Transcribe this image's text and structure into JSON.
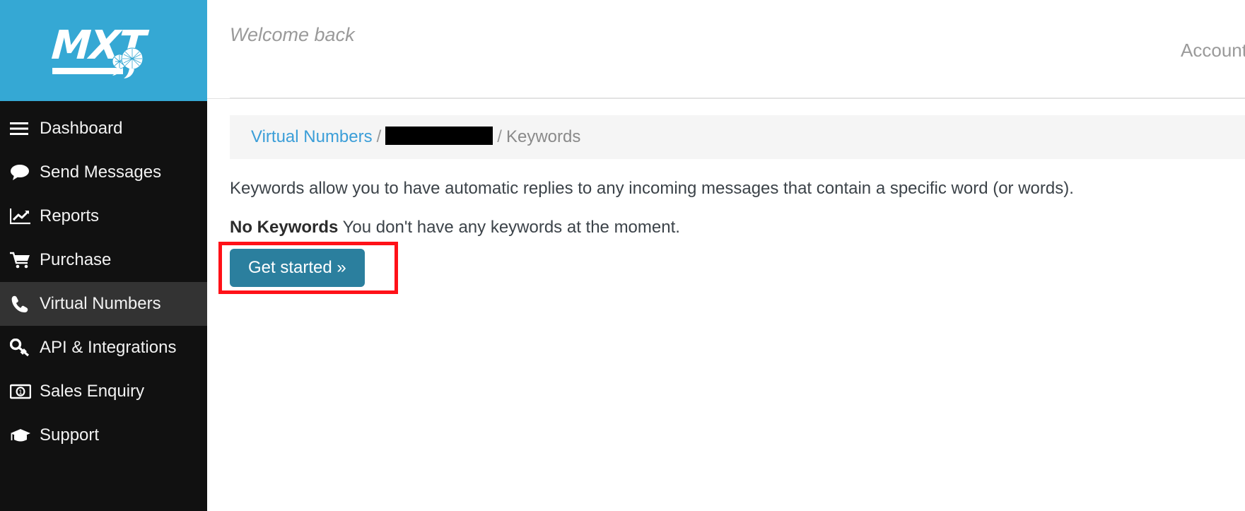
{
  "colors": {
    "brand_blue": "#35a8d4",
    "sidebar_bg": "#111111",
    "sidebar_active_bg": "#333333",
    "link_blue": "#3b9ed8",
    "button_blue": "#2b7f9e",
    "highlight_red": "#ff1118",
    "breadcrumb_bg": "#f5f5f5",
    "muted_text": "#9a9a9a"
  },
  "sidebar": {
    "logo_text": "MXT",
    "logo_icon": "brain-quote-icon",
    "items": [
      {
        "label": "Dashboard",
        "icon": "hamburger-menu-icon",
        "active": false
      },
      {
        "label": "Send Messages",
        "icon": "speech-bubble-icon",
        "active": false
      },
      {
        "label": "Reports",
        "icon": "line-chart-icon",
        "active": false
      },
      {
        "label": "Purchase",
        "icon": "shopping-cart-icon",
        "active": false
      },
      {
        "label": "Virtual Numbers",
        "icon": "phone-icon",
        "active": true
      },
      {
        "label": "API & Integrations",
        "icon": "key-icon",
        "active": false
      },
      {
        "label": "Sales Enquiry",
        "icon": "banknote-icon",
        "active": false
      },
      {
        "label": "Support",
        "icon": "graduation-cap-icon",
        "active": false
      }
    ]
  },
  "topbar": {
    "welcome": "Welcome back",
    "account_balance": "Account Ba"
  },
  "breadcrumb": {
    "root": "Virtual Numbers",
    "separator": "/",
    "redacted": "",
    "current": "Keywords"
  },
  "main": {
    "intro": "Keywords allow you to have automatic replies to any incoming messages that contain a specific word (or words).",
    "status_title": "No Keywords",
    "status_text": "You don't have any keywords at the moment.",
    "cta_label": "Get started »"
  }
}
